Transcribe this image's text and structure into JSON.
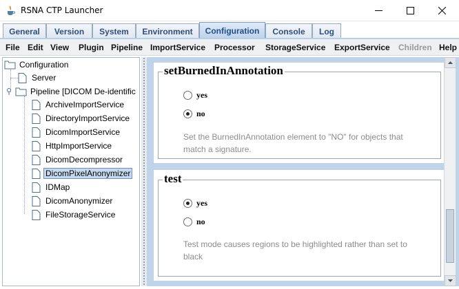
{
  "window": {
    "title": "RSNA CTP Launcher",
    "icons": [
      "java-app-icon",
      "minimize-icon",
      "maximize-icon",
      "close-icon"
    ]
  },
  "tabs": [
    {
      "label": "General",
      "active": false
    },
    {
      "label": "Version",
      "active": false
    },
    {
      "label": "System",
      "active": false
    },
    {
      "label": "Environment",
      "active": false
    },
    {
      "label": "Configuration",
      "active": true
    },
    {
      "label": "Console",
      "active": false
    },
    {
      "label": "Log",
      "active": false
    }
  ],
  "menu": [
    {
      "label": "File",
      "enabled": true
    },
    {
      "label": "Edit",
      "enabled": true
    },
    {
      "label": "View",
      "enabled": true
    },
    {
      "label": "Plugin",
      "enabled": true
    },
    {
      "label": "Pipeline",
      "enabled": true
    },
    {
      "label": "ImportService",
      "enabled": true
    },
    {
      "label": "Processor",
      "enabled": true
    },
    {
      "label": "StorageService",
      "enabled": true
    },
    {
      "label": "ExportService",
      "enabled": true
    },
    {
      "label": "Children",
      "enabled": false
    },
    {
      "label": "Help",
      "enabled": true
    }
  ],
  "tree": {
    "root": "Configuration",
    "items": [
      {
        "label": "Server",
        "type": "file",
        "selected": false
      },
      {
        "label": "Pipeline [DICOM De-identific",
        "type": "folder",
        "selected": false
      },
      {
        "label": "ArchiveImportService",
        "type": "file",
        "selected": false
      },
      {
        "label": "DirectoryImportService",
        "type": "file",
        "selected": false
      },
      {
        "label": "DicomImportService",
        "type": "file",
        "selected": false
      },
      {
        "label": "HttpImportService",
        "type": "file",
        "selected": false
      },
      {
        "label": "DicomDecompressor",
        "type": "file",
        "selected": false
      },
      {
        "label": "DicomPixelAnonymizer",
        "type": "file",
        "selected": true
      },
      {
        "label": "IDMap",
        "type": "file",
        "selected": false
      },
      {
        "label": "DicomAnonymizer",
        "type": "file",
        "selected": false
      },
      {
        "label": "FileStorageService",
        "type": "file",
        "selected": false
      }
    ]
  },
  "attributes": [
    {
      "name": "setBurnedInAnnotation",
      "options": [
        {
          "label": "yes",
          "checked": false
        },
        {
          "label": "no",
          "checked": true
        }
      ],
      "description_lines": [
        "Set the BurnedInAnnotation element to \"NO\" for objects that",
        "match a signature."
      ]
    },
    {
      "name": "test",
      "options": [
        {
          "label": "yes",
          "checked": true
        },
        {
          "label": "no",
          "checked": false
        }
      ],
      "description_lines": [
        "Test mode causes regions to be highlighted rather than set to",
        "black"
      ]
    }
  ],
  "scroll": {
    "position_fraction": 0.92
  },
  "colors": {
    "panel_bg": "#bfd4ea",
    "tab_text": "#2d4f7c",
    "selection": "#c7d9ee"
  }
}
